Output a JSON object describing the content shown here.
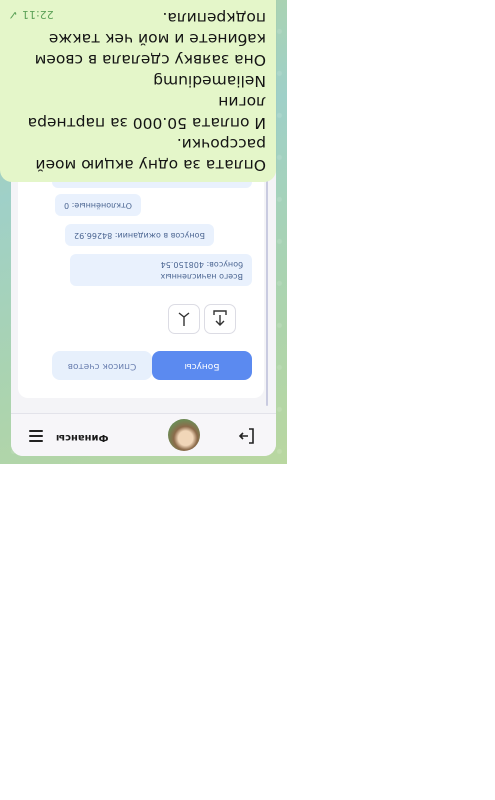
{
  "app": {
    "title": "Финансы",
    "tabs": {
      "bonuses": "Бонусы",
      "accounts": "Список счетов"
    },
    "stats": {
      "total_label": "Всего начисленных",
      "total": "бонусов: 408150.54",
      "pending": "Бонусов в ожидании: 84266.92",
      "rejected": "Отклонённые: 0"
    },
    "icons": [
      "menu-icon",
      "avatar",
      "logout-icon",
      "upload-icon",
      "share-icon"
    ]
  },
  "message": {
    "text": "Оплата за одну акцию моей рассрочки.\nИ оплата 50.000 за партнера логин\nNeliamediumg\nОна заявку сделала в своем кабинете  и мой чек также подкрепила.",
    "time": "22:11",
    "status": "✓"
  },
  "colors": {
    "accent": "#5b8af0",
    "bubble": "#e4f6c9"
  }
}
